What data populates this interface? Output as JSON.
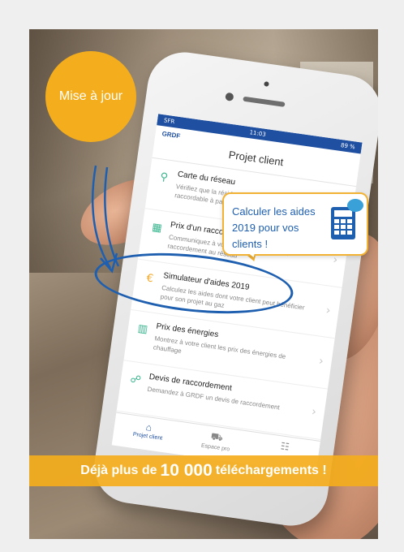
{
  "badge": {
    "text": "Mise à jour"
  },
  "phone": {
    "status": {
      "carrier": "SFR",
      "time": "11:03",
      "battery": "89 %"
    },
    "logo": "GRDF",
    "title": "Projet client",
    "items": [
      {
        "icon": "map-pin-icon",
        "glyph": "⚲",
        "title": "Carte du réseau",
        "desc": "Vérifiez que la résidence de votre client est raccordable à partir de l'adresse de votre client"
      },
      {
        "icon": "calculator-icon",
        "glyph": "▦",
        "title": "Prix d'un raccordement",
        "desc": "Communiquez à votre client le prix de son raccordement au réseau"
      },
      {
        "icon": "euro-icon",
        "glyph": "€",
        "title": "Simulateur d'aides 2019",
        "desc": "Calculez les aides dont votre client peut bénéficier pour son projet au gaz"
      },
      {
        "icon": "chart-icon",
        "glyph": "▥",
        "title": "Prix des énergies",
        "desc": "Montrez à votre client les prix des énergies de chauffage"
      },
      {
        "icon": "connect-icon",
        "glyph": "☍",
        "title": "Devis de raccordement",
        "desc": "Demandez à GRDF un devis de raccordement"
      }
    ],
    "tabs": [
      {
        "icon": "home-icon",
        "glyph": "⌂",
        "label": "Projet client"
      },
      {
        "icon": "truck-icon",
        "glyph": "⛟",
        "label": "Espace pro"
      },
      {
        "icon": "contact-icon",
        "glyph": "☷",
        "label": ""
      }
    ]
  },
  "bubble": {
    "text": "Calculer les aides 2019 pour vos clients !"
  },
  "banner": {
    "prefix": "Déjà plus de",
    "number": "10 000",
    "suffix": "téléchargements !"
  },
  "colors": {
    "orange": "#f4ae1d",
    "blue": "#1f5fb0",
    "green": "#38b58e"
  }
}
